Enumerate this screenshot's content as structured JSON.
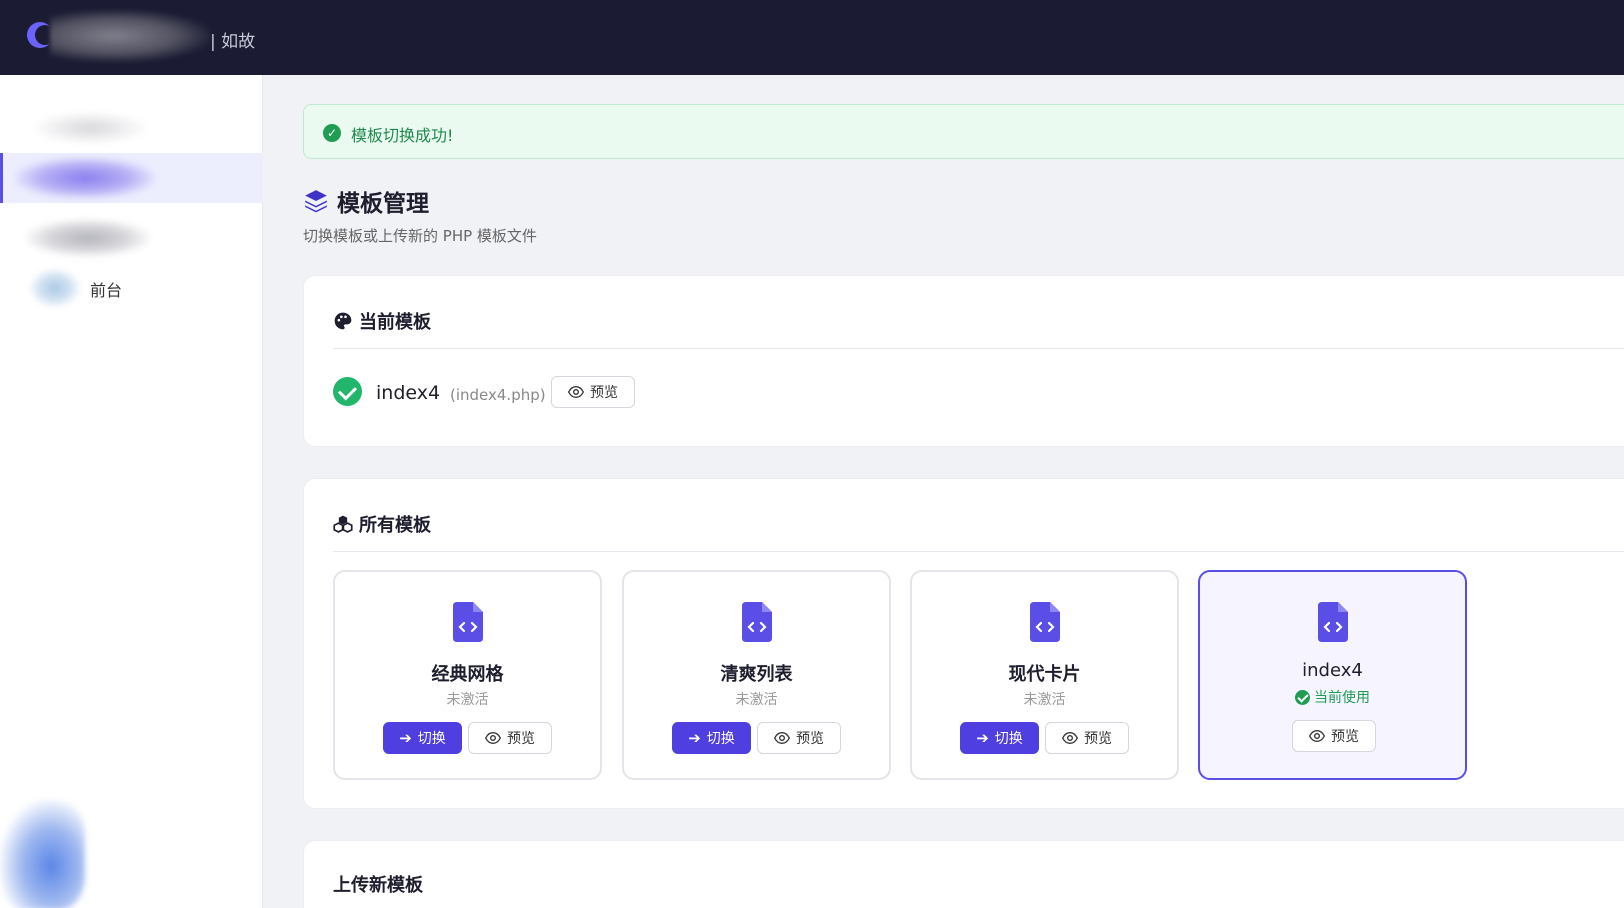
{
  "brand": {
    "suffix": "| 如故"
  },
  "sidebar": {
    "items": [
      {
        "label": ""
      },
      {
        "label": ""
      },
      {
        "label": ""
      },
      {
        "label": "前台"
      }
    ]
  },
  "alert": {
    "text": "模板切换成功!"
  },
  "page": {
    "title": "模板管理",
    "subtitle": "切换模板或上传新的 PHP 模板文件"
  },
  "current": {
    "heading": "当前模板",
    "name": "index4",
    "file": "(index4.php)",
    "preview_label": "预览"
  },
  "all": {
    "heading": "所有模板",
    "templates": [
      {
        "name": "经典网格",
        "status": "未激活",
        "switch_label": "切换",
        "preview_label": "预览"
      },
      {
        "name": "清爽列表",
        "status": "未激活",
        "switch_label": "切换",
        "preview_label": "预览"
      },
      {
        "name": "现代卡片",
        "status": "未激活",
        "switch_label": "切换",
        "preview_label": "预览"
      },
      {
        "name": "index4",
        "status": "当前使用",
        "preview_label": "预览"
      }
    ]
  },
  "upload": {
    "heading": "上传新模板"
  },
  "colors": {
    "accent": "#4f3ee0",
    "topbar": "#1b1c33",
    "success": "#1f9d55"
  }
}
